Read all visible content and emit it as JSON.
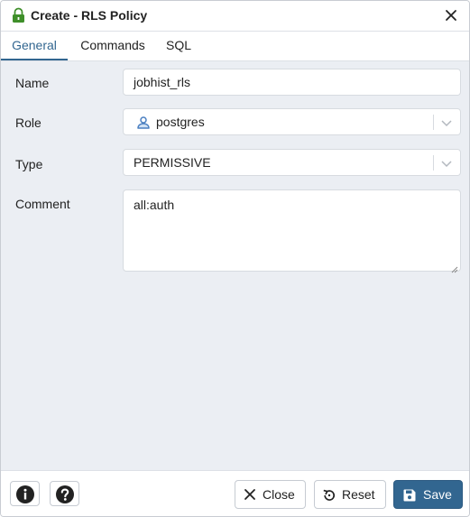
{
  "dialog": {
    "title": "Create - RLS Policy",
    "title_icon": "lock-icon",
    "close_icon": "close-icon"
  },
  "tabs": [
    {
      "label": "General",
      "active": true
    },
    {
      "label": "Commands",
      "active": false
    },
    {
      "label": "SQL",
      "active": false
    }
  ],
  "form": {
    "name": {
      "label": "Name",
      "value": "jobhist_rls"
    },
    "role": {
      "label": "Role",
      "value": "postgres",
      "icon": "user-icon"
    },
    "type": {
      "label": "Type",
      "value": "PERMISSIVE"
    },
    "comment": {
      "label": "Comment",
      "value": "all:auth"
    }
  },
  "footer": {
    "info_icon": "info-icon",
    "help_icon": "help-icon",
    "close_label": "Close",
    "reset_label": "Reset",
    "save_label": "Save"
  },
  "colors": {
    "accent": "#326690",
    "body_bg": "#ebeef3",
    "lock_green": "#3f8f2a",
    "role_icon_blue": "#4a7fc1"
  }
}
